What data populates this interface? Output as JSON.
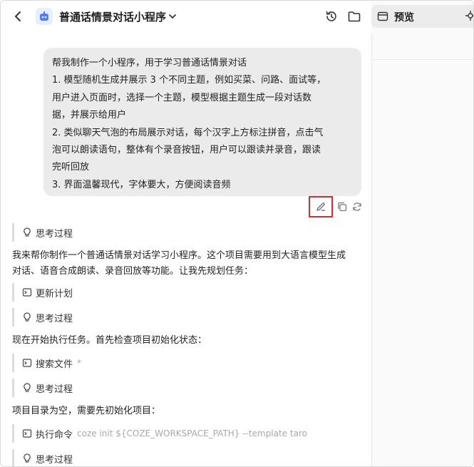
{
  "header": {
    "title": "普通话情景对话小程序",
    "icons": {
      "back": "chevron-left-icon",
      "app": "robot-icon",
      "dropdown": "chevron-down-icon",
      "history": "history-icon",
      "folder": "folder-icon"
    }
  },
  "preview": {
    "tab_label": "预览",
    "icon": "window-icon"
  },
  "user_message": {
    "lines": [
      "帮我制作一个小程序，用于学习普通话情景对话",
      "1. 模型随机生成并展示 3 个不同主题，例如买菜、问路、面试等，",
      "用户进入页面时，选择一个主题，模型根据主题生成一段对话数",
      "据，并展示给用户",
      "2. 类似聊天气泡的布局展示对话，每个汉字上方标注拼音，点击气",
      "泡可以朗读语句，整体有个录音按钮，用户可以跟读并录音，跟读",
      "完听回放",
      "3. 界面温馨现代，字体要大，方便阅读音频"
    ]
  },
  "steps": [
    {
      "label": "思考过程",
      "icon": "lightbulb-icon"
    },
    {
      "label": "更新计划",
      "icon": "terminal-icon"
    },
    {
      "label": "思考过程",
      "icon": "lightbulb-icon"
    },
    {
      "label": "搜索文件",
      "extra": "*",
      "icon": "terminal-icon"
    },
    {
      "label": "思考过程",
      "icon": "lightbulb-icon"
    },
    {
      "label": "执行命令",
      "extra": "coze init ${COZE_WORKSPACE_PATH} --template taro",
      "icon": "terminal-icon"
    },
    {
      "label": "思考过程",
      "icon": "lightbulb-icon"
    }
  ],
  "paragraphs": [
    [
      "我来帮你制作一个普通话情景对话学习小程序。这个项目需要用到大语言模型生成",
      "对话、语音合成朗读、录音回放等功能。让我先规划任务："
    ],
    [
      "现在开始执行任务。首先检查项目初始化状态："
    ],
    [
      "项目目录为空，需要先初始化项目："
    ]
  ],
  "colors": {
    "accent_red": "#d92d2d",
    "bubble_bg": "#ebebeb"
  }
}
